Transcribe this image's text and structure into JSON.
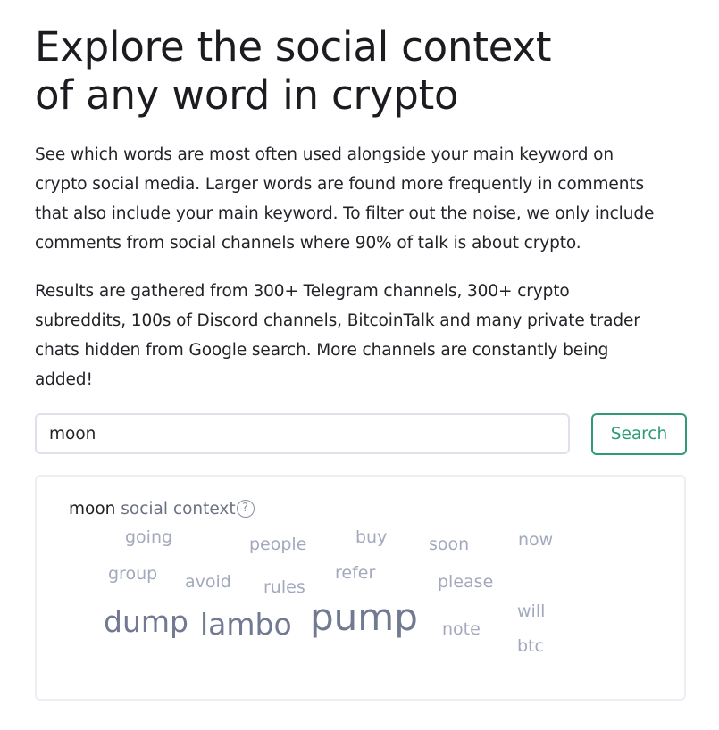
{
  "hero": {
    "title_line1": "Explore the social context",
    "title_line2": "of any word in crypto"
  },
  "intro": {
    "para1_lines": [
      "See which words are most often used alongside your main keyword on",
      "crypto social media. Larger words are found more frequently in comments",
      "that also include your main keyword. To filter out the noise, we only include",
      "comments from social channels where 90% of talk is about crypto."
    ],
    "para2_lines": [
      "Results are gathered from 300+ Telegram channels, 300+ crypto",
      "subreddits, 100s of Discord channels, BitcoinTalk and many private trader",
      "chats hidden from Google search. More channels are constantly being",
      "added!"
    ]
  },
  "search": {
    "value": "moon",
    "button_label": "Search"
  },
  "cloud": {
    "keyword": "moon",
    "suffix": " social context",
    "help_icon_glyph": "?",
    "words": [
      {
        "text": "going",
        "size": "small"
      },
      {
        "text": "people",
        "size": "small"
      },
      {
        "text": "buy",
        "size": "small"
      },
      {
        "text": "soon",
        "size": "small"
      },
      {
        "text": "now",
        "size": "small"
      },
      {
        "text": "group",
        "size": "small"
      },
      {
        "text": "avoid",
        "size": "small"
      },
      {
        "text": "rules",
        "size": "small"
      },
      {
        "text": "refer",
        "size": "small"
      },
      {
        "text": "please",
        "size": "small"
      },
      {
        "text": "dump",
        "size": "large"
      },
      {
        "text": "lambo",
        "size": "large"
      },
      {
        "text": "pump",
        "size": "largest"
      },
      {
        "text": "note",
        "size": "small"
      },
      {
        "text": "will",
        "size": "small"
      },
      {
        "text": "btc",
        "size": "small"
      }
    ]
  },
  "colors": {
    "accent": "#2e9a7a",
    "cloud_small": "#a3a9bd",
    "cloud_large": "#727a93",
    "border": "#dfe1ea"
  }
}
